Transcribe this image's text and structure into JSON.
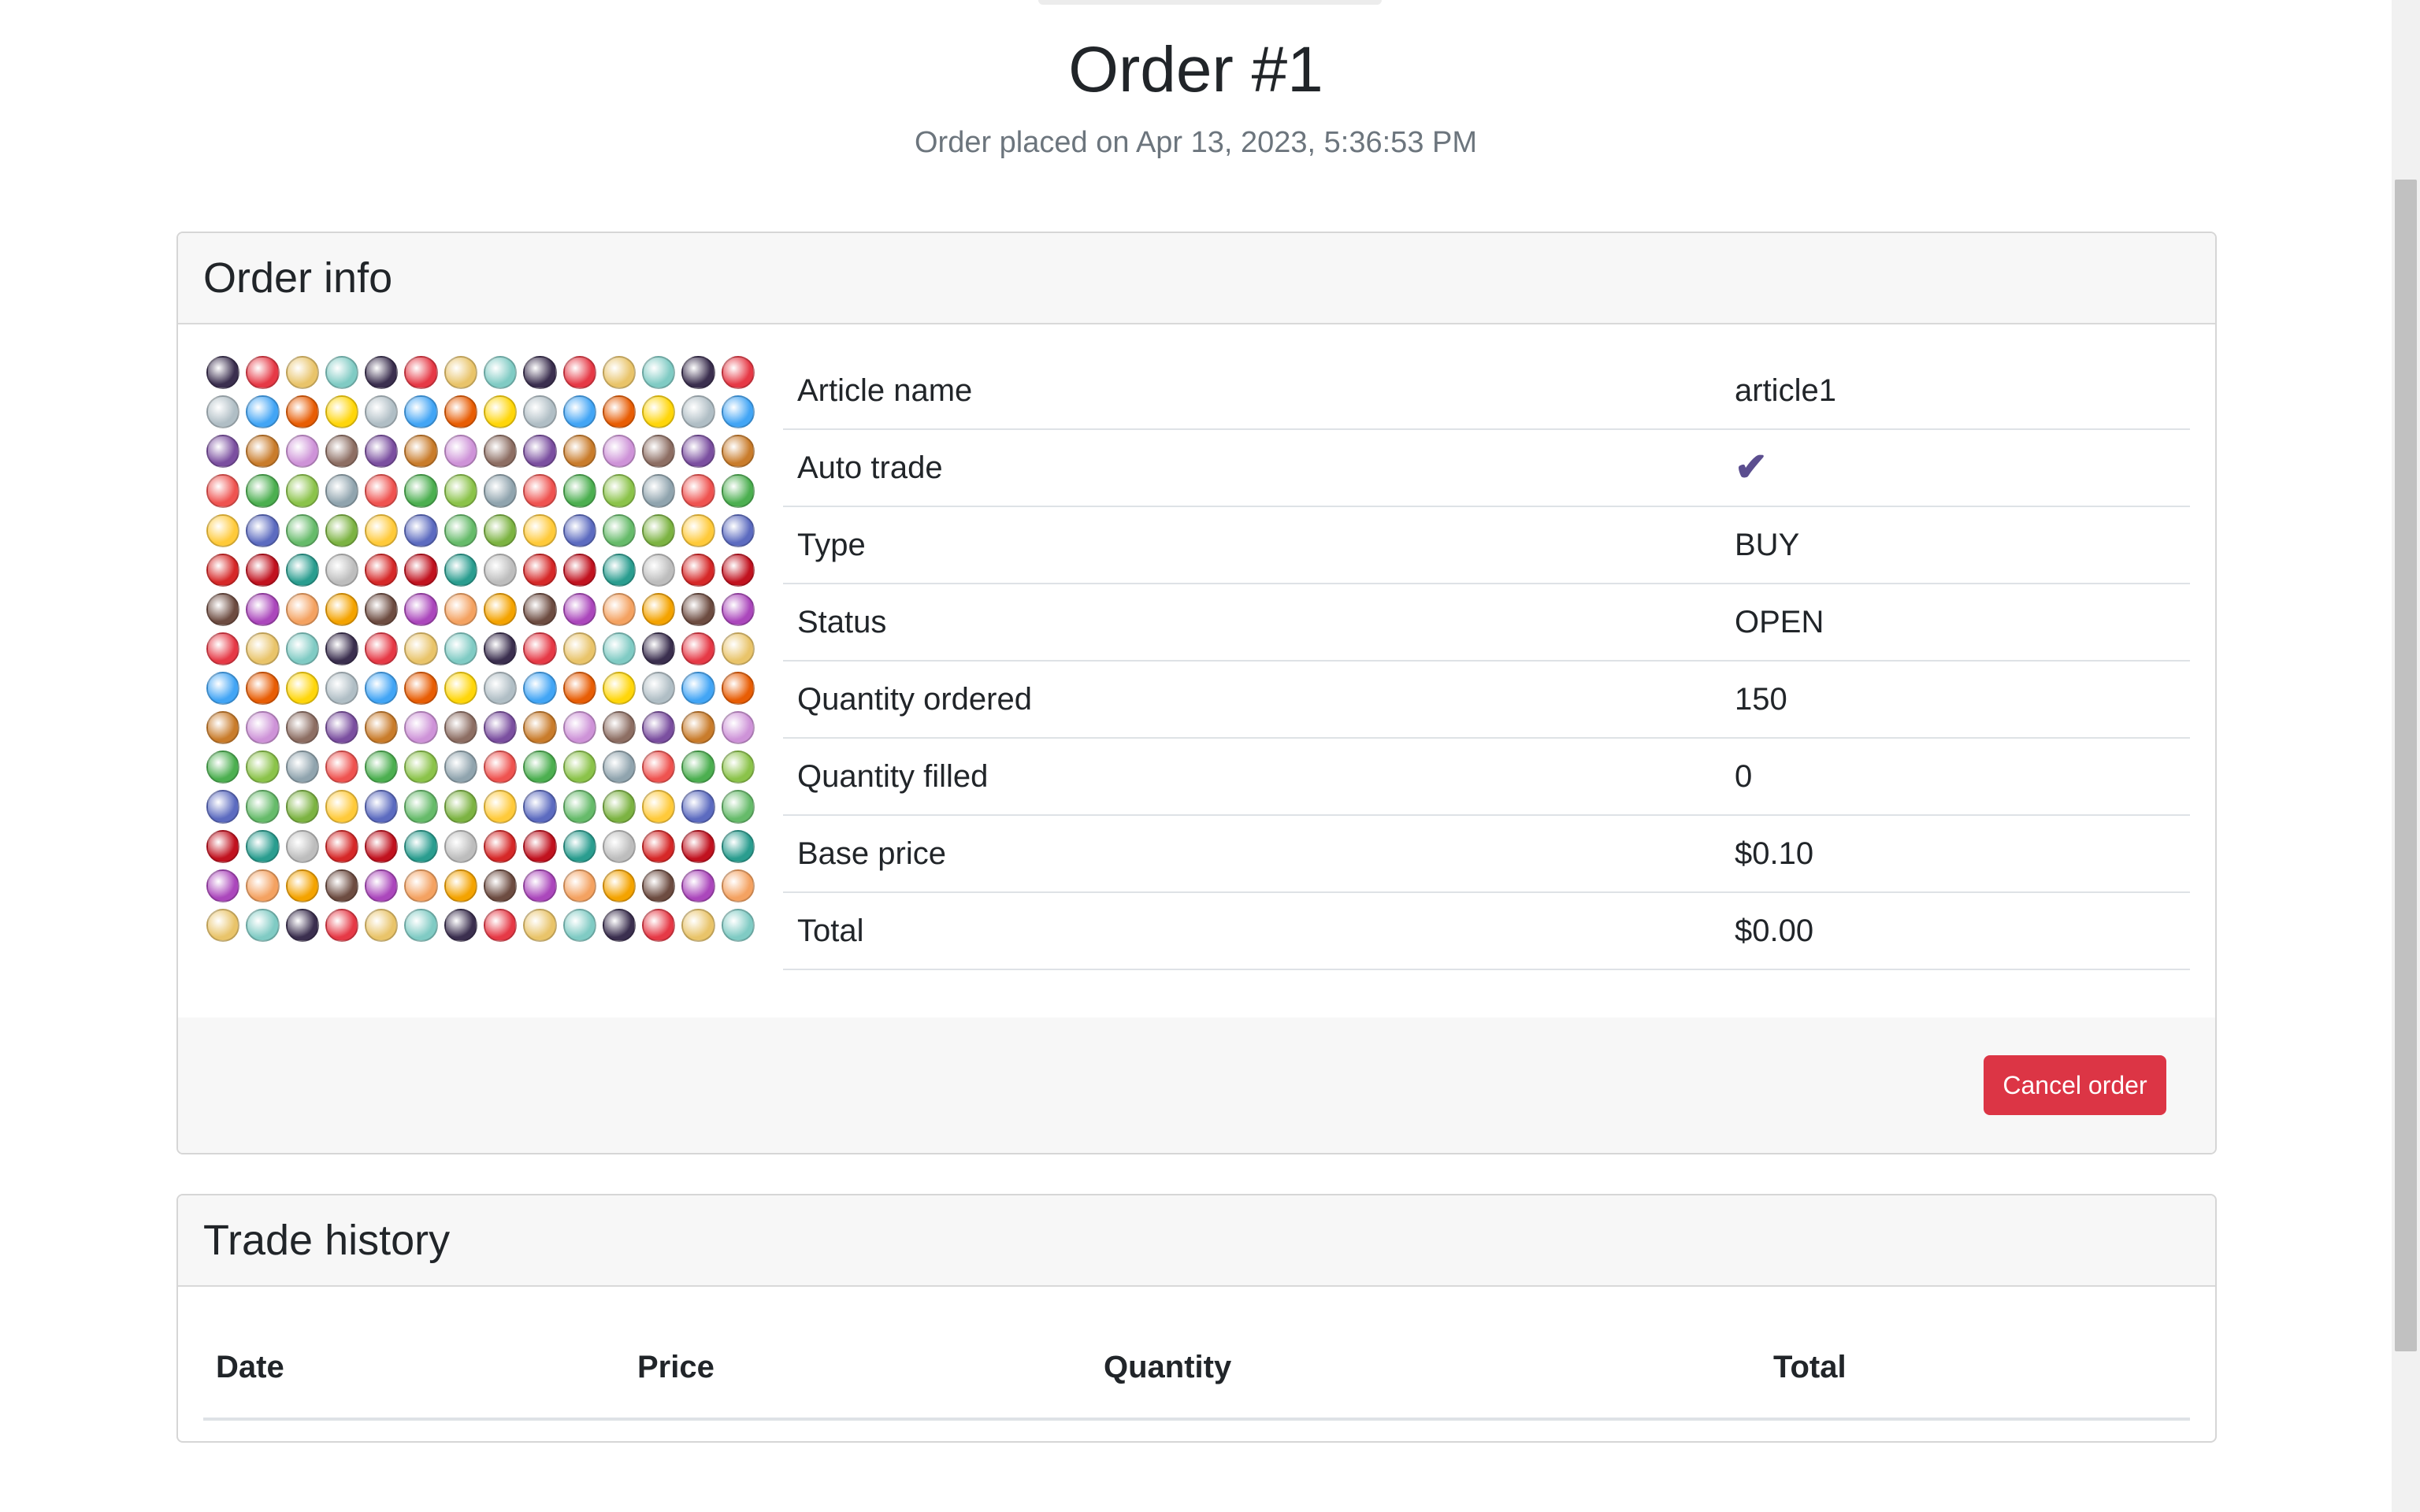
{
  "page": {
    "title": "Order #1",
    "subtitle": "Order placed on Apr 13, 2023, 5:36:53 PM"
  },
  "order_info": {
    "header": "Order info",
    "image_icon": "game-items-sprite-sheet-icon",
    "rows": [
      {
        "label": "Article name",
        "value": "article1"
      },
      {
        "label": "Auto trade",
        "value": "✔"
      },
      {
        "label": "Type",
        "value": "BUY"
      },
      {
        "label": "Status",
        "value": "OPEN"
      },
      {
        "label": "Quantity ordered",
        "value": "150"
      },
      {
        "label": "Quantity filled",
        "value": "0"
      },
      {
        "label": "Base price",
        "value": "$0.10"
      },
      {
        "label": "Total",
        "value": "$0.00"
      }
    ],
    "cancel_label": "Cancel order"
  },
  "trade_history": {
    "header": "Trade history",
    "columns": [
      "Date",
      "Price",
      "Quantity",
      "Total"
    ]
  },
  "colors": {
    "danger": "#dc3545",
    "check": "#5b4e8f",
    "muted": "#6c757d"
  }
}
